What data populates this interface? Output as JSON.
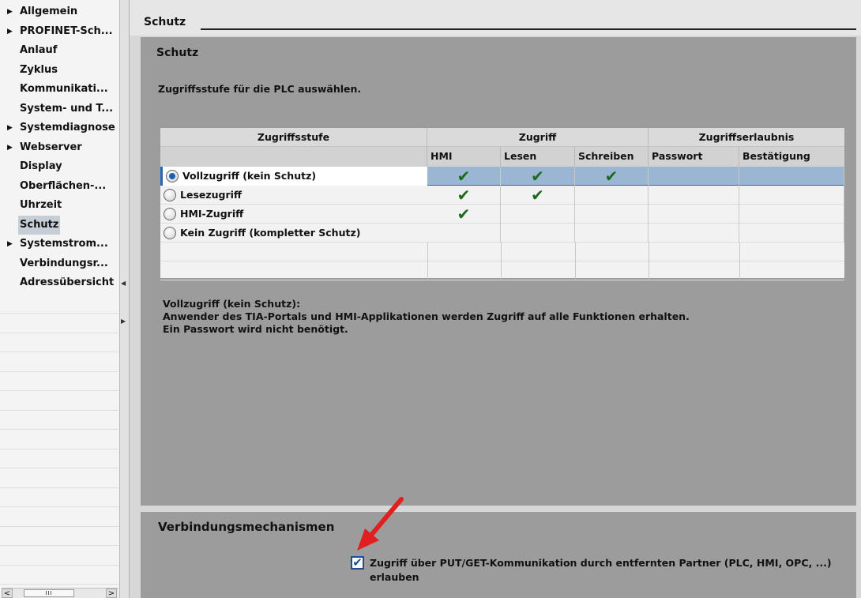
{
  "sidebar": {
    "items": [
      {
        "label": "Allgemein",
        "expandable": true
      },
      {
        "label": "PROFINET-Sch...",
        "expandable": true
      },
      {
        "label": "Anlauf",
        "expandable": false
      },
      {
        "label": "Zyklus",
        "expandable": false
      },
      {
        "label": "Kommunikati...",
        "expandable": false
      },
      {
        "label": "System- und T...",
        "expandable": false
      },
      {
        "label": "Systemdiagnose",
        "expandable": true
      },
      {
        "label": "Webserver",
        "expandable": true
      },
      {
        "label": "Display",
        "expandable": false
      },
      {
        "label": "Oberflächen-...",
        "expandable": false
      },
      {
        "label": "Uhrzeit",
        "expandable": false
      },
      {
        "label": "Schutz",
        "expandable": false,
        "selected": true
      },
      {
        "label": "Systemstrom...",
        "expandable": true
      },
      {
        "label": "Verbindungsr...",
        "expandable": false
      },
      {
        "label": "Adressübersicht",
        "expandable": false
      }
    ],
    "scroll_left": "<",
    "scroll_thumb": "III",
    "scroll_right": ">"
  },
  "header": {
    "title": "Schutz"
  },
  "schutz": {
    "title": "Schutz",
    "instruction": "Zugriffsstufe für die PLC auswählen.",
    "table": {
      "group_headers": [
        "Zugriffsstufe",
        "Zugriff",
        "Zugriffserlaubnis"
      ],
      "columns": [
        "HMI",
        "Lesen",
        "Schreiben",
        "Passwort",
        "Bestätigung"
      ],
      "rows": [
        {
          "label": "Vollzugriff (kein Schutz)",
          "selected": true,
          "hmi": "✔",
          "lesen": "✔",
          "schreiben": "✔"
        },
        {
          "label": "Lesezugriff",
          "selected": false,
          "hmi": "✔",
          "lesen": "✔",
          "schreiben": ""
        },
        {
          "label": "HMI-Zugriff",
          "selected": false,
          "hmi": "✔",
          "lesen": "",
          "schreiben": ""
        },
        {
          "label": "Kein Zugriff (kompletter Schutz)",
          "selected": false,
          "hmi": "",
          "lesen": "",
          "schreiben": ""
        }
      ]
    },
    "description": {
      "title": "Vollzugriff (kein Schutz):",
      "line1": "Anwender des TIA-Portals und HMI-Applikationen werden Zugriff auf alle Funktionen erhalten.",
      "line2": "Ein Passwort wird nicht benötigt."
    }
  },
  "verbindung": {
    "title": "Verbindungsmechanismen",
    "checkbox_checked": true,
    "checkbox_label_line1": "Zugriff über PUT/GET-Kommunikation durch entfernten Partner (PLC, HMI, OPC, ...)",
    "checkbox_label_line2": "erlauben"
  },
  "colors": {
    "selection": "#9bb6d3",
    "check_green": "#1c6b1c",
    "annotation_arrow": "#e02020"
  }
}
